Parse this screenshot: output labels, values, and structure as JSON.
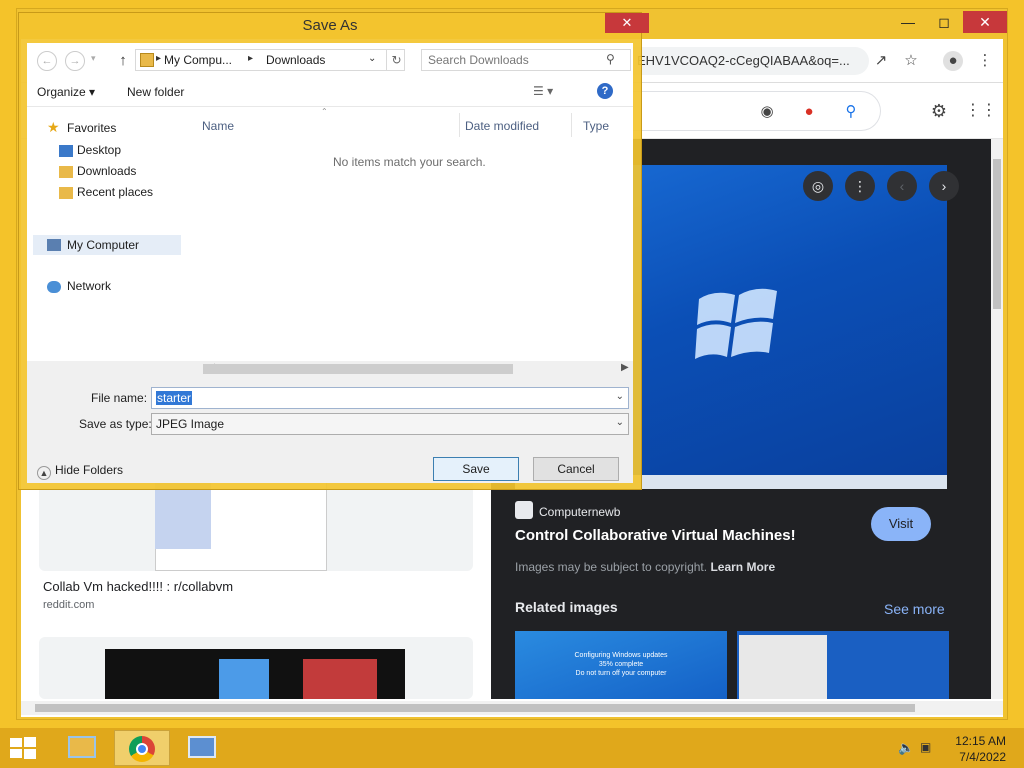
{
  "dialog": {
    "title": "Save As",
    "close_label": "✕",
    "breadcrumb": [
      "My Compu...",
      "Downloads"
    ],
    "search_placeholder": "Search Downloads",
    "toolbar": {
      "organize": "Organize ▾",
      "new_folder": "New folder"
    },
    "nav": {
      "favorites": "Favorites",
      "desktop": "Desktop",
      "downloads": "Downloads",
      "recent": "Recent places",
      "my_computer": "My Computer",
      "network": "Network"
    },
    "columns": {
      "name": "Name",
      "date_modified": "Date modified",
      "type": "Type"
    },
    "empty_message": "No items match your search.",
    "file_name_label": "File name:",
    "file_name_value": "starter",
    "save_as_type_label": "Save as type:",
    "save_as_type_value": "JPEG Image",
    "hide_folders": "Hide Folders",
    "save_button": "Save",
    "cancel_button": "Cancel"
  },
  "browser": {
    "url_fragment": "EHV1VCOAQ2-cCegQIABAA&oq=...",
    "result": {
      "title": "Collab Vm hacked!!!! : r/collabvm",
      "source": "reddit.com"
    },
    "preview": {
      "source_name": "Computernewb",
      "title": "Control Collaborative Virtual Machines!",
      "visit": "Visit",
      "copyright": "Images may be subject to copyright.",
      "learn_more": "Learn More",
      "related": "Related images",
      "see_more": "See more",
      "related_thumb_text": "Configuring Windows updates\n35% complete\nDo not turn off your computer"
    }
  },
  "taskbar": {
    "time": "12:15 AM",
    "date": "7/4/2022"
  },
  "colors": {
    "desktop": "#f4c32a",
    "accent_blue": "#8ab4f8",
    "dark_panel": "#202124",
    "close_red": "#c7383b"
  }
}
